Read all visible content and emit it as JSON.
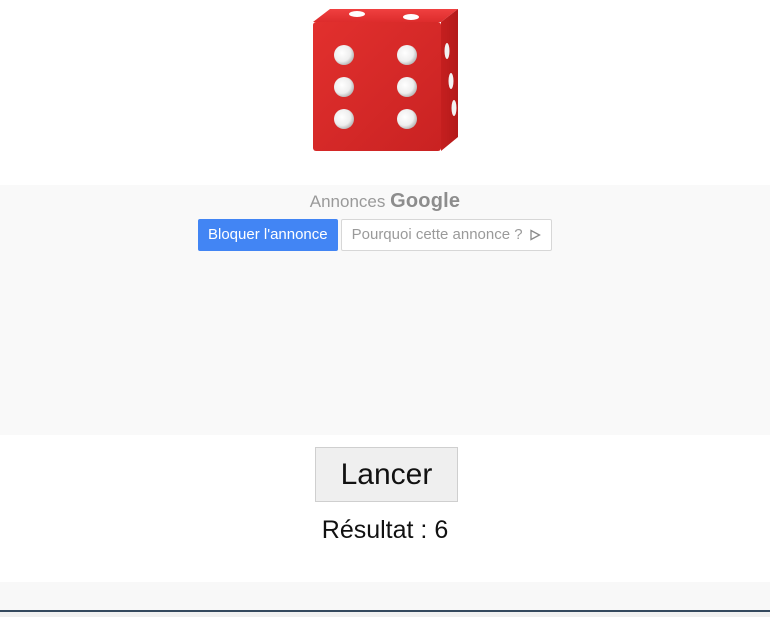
{
  "dice": {
    "face_value": 6,
    "color": "#d92a2a"
  },
  "ad": {
    "label": "Annonces",
    "brand": "Google",
    "block_button_label": "Bloquer l'annonce",
    "why_button_label": "Pourquoi cette annonce ?",
    "why_icon": "play-triangle-icon",
    "accent_color": "#4285f4"
  },
  "controls": {
    "roll_button_label": "Lancer",
    "result_text": "Résultat : 6"
  }
}
